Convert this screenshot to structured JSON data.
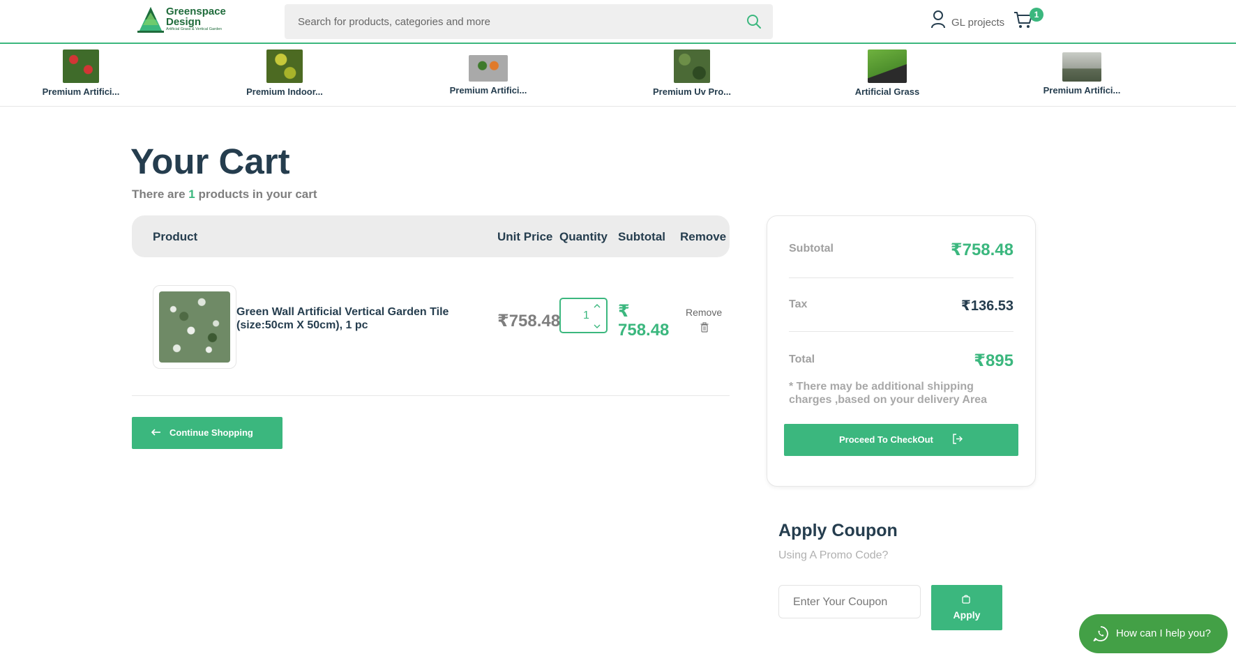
{
  "header": {
    "logo_name": "Greenspace Design",
    "logo_tagline": "Artificial Grass & Vertical Garden",
    "search_placeholder": "Search for products, categories and more",
    "user_label": "GL projects",
    "cart_count": "1"
  },
  "categories": [
    {
      "label": "Premium Artifici...",
      "thumb_color": "#a32a2a"
    },
    {
      "label": "Premium Indoor...",
      "thumb_color": "#7f8c1f"
    },
    {
      "label": "Premium Artifici...",
      "thumb_color": "#9a9a9a"
    },
    {
      "label": "Premium Uv Pro...",
      "thumb_color": "#3d5a2a"
    },
    {
      "label": "Artificial Grass",
      "thumb_color": "#4d8e2c"
    },
    {
      "label": "Premium Artifici...",
      "thumb_color": "#8c8f8a"
    }
  ],
  "cart": {
    "title": "Your Cart",
    "count_prefix": "There are",
    "count": "1",
    "count_suffix": "products in your cart",
    "columns": [
      "Product",
      "Unit Price",
      "Quantity",
      "Subtotal",
      "Remove"
    ],
    "items": [
      {
        "name": "Green Wall Artificial Vertical Garden Tile (size:50cm X 50cm), 1 pc",
        "unit_price": "₹758.48",
        "quantity": "1",
        "subtotal_currency": "₹",
        "subtotal_value": "758.48",
        "remove_label": "Remove"
      }
    ],
    "continue_label": "Continue Shopping"
  },
  "summary": {
    "subtotal_label": "Subtotal",
    "subtotal_value": "₹758.48",
    "tax_label": "Tax",
    "tax_value": "₹136.53",
    "total_label": "Total",
    "total_value": "₹895",
    "shipping_note": "* There may be additional shipping charges ,based on your delivery Area",
    "checkout_label": "Proceed To CheckOut"
  },
  "coupon": {
    "title": "Apply Coupon",
    "subtitle": "Using A Promo Code?",
    "placeholder": "Enter Your Coupon",
    "apply_label": "Apply"
  },
  "whatsapp": {
    "label": "How can I help you?"
  },
  "colors": {
    "accent": "#3bb77e",
    "heading": "#253d4e",
    "muted": "#7e7e7e",
    "whatsapp": "#43a046"
  }
}
